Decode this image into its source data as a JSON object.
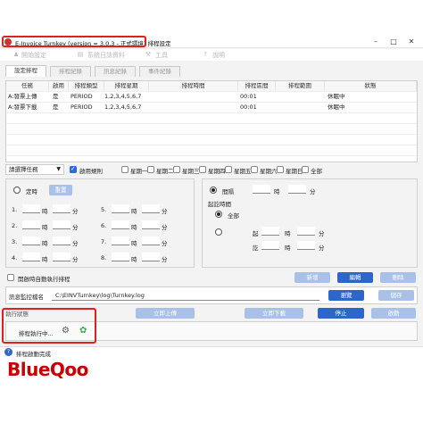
{
  "window": {
    "title": "E-Invoice Turnkey (version = 3.0.3 - 正式環境) 排程設定",
    "minimize": "–",
    "maximize": "□",
    "close": "✕"
  },
  "menu": {
    "items": [
      "開始設定",
      "系統日誌資料",
      "工具",
      "說明"
    ]
  },
  "tabs": [
    "設定排程",
    "排程紀錄",
    "訊息紀錄",
    "事件紀錄"
  ],
  "table": {
    "headers": [
      "任務",
      "啟用",
      "排程類型",
      "排程星期",
      "排程時間",
      "排程區間",
      "排程範圍",
      "狀態"
    ],
    "rows": [
      [
        "A:發票上傳",
        "是",
        "PERIOD",
        "1,2,3,4,5,6,7",
        "",
        "00:01",
        "",
        "休眠中"
      ],
      [
        "A:發票下載",
        "是",
        "PERIOD",
        "1,2,3,4,5,6,7",
        "",
        "00:01",
        "",
        "休眠中"
      ]
    ]
  },
  "task_select": {
    "value": "請選擇任務"
  },
  "weekday_checks": [
    {
      "label": "啟用規則",
      "checked": true
    },
    {
      "label": "星期一",
      "checked": false
    },
    {
      "label": "星期二",
      "checked": false
    },
    {
      "label": "星期三",
      "checked": false
    },
    {
      "label": "星期四",
      "checked": false
    },
    {
      "label": "星期五",
      "checked": false
    },
    {
      "label": "星期六",
      "checked": false
    },
    {
      "label": "星期日",
      "checked": false
    },
    {
      "label": "全部",
      "checked": false
    }
  ],
  "fixed_time": {
    "radio_label": "定時",
    "reset_button": "重置",
    "rows": [
      {
        "n1": "1.",
        "n2": "5."
      },
      {
        "n1": "2.",
        "n2": "6."
      },
      {
        "n1": "3.",
        "n2": "7."
      },
      {
        "n1": "4.",
        "n2": "8."
      }
    ],
    "hour_unit": "時",
    "minute_unit": "分"
  },
  "interval": {
    "radio_label": "間隔",
    "hour_unit": "時",
    "minute_unit": "分",
    "range_label": "起訖時間",
    "all_label": "全部",
    "start_label": "起",
    "end_label": "訖"
  },
  "autorun": {
    "label": "開啟時自動執行排程",
    "checked": false
  },
  "actions": {
    "add": "新增",
    "edit": "編輯",
    "delete": "刪除"
  },
  "monitor": {
    "label": "訊息監控檔名",
    "path": "C:\\EINVTurnkey\\log\\Turnkey.log",
    "browse": "瀏覽",
    "save": "儲存"
  },
  "run_status": {
    "group_label": "執行狀態",
    "upload_now": "立即上傳",
    "download_now": "立即下載",
    "stop": "停止",
    "start": "啟動",
    "running_text": "排程執行中..."
  },
  "statusbar": {
    "text": "排程啟動完成"
  },
  "watermark": {
    "text": "BlueQoo"
  },
  "colors": {
    "accent": "#2d66c8",
    "highlight_box": "#e0201b",
    "watermark": "#c80000"
  }
}
